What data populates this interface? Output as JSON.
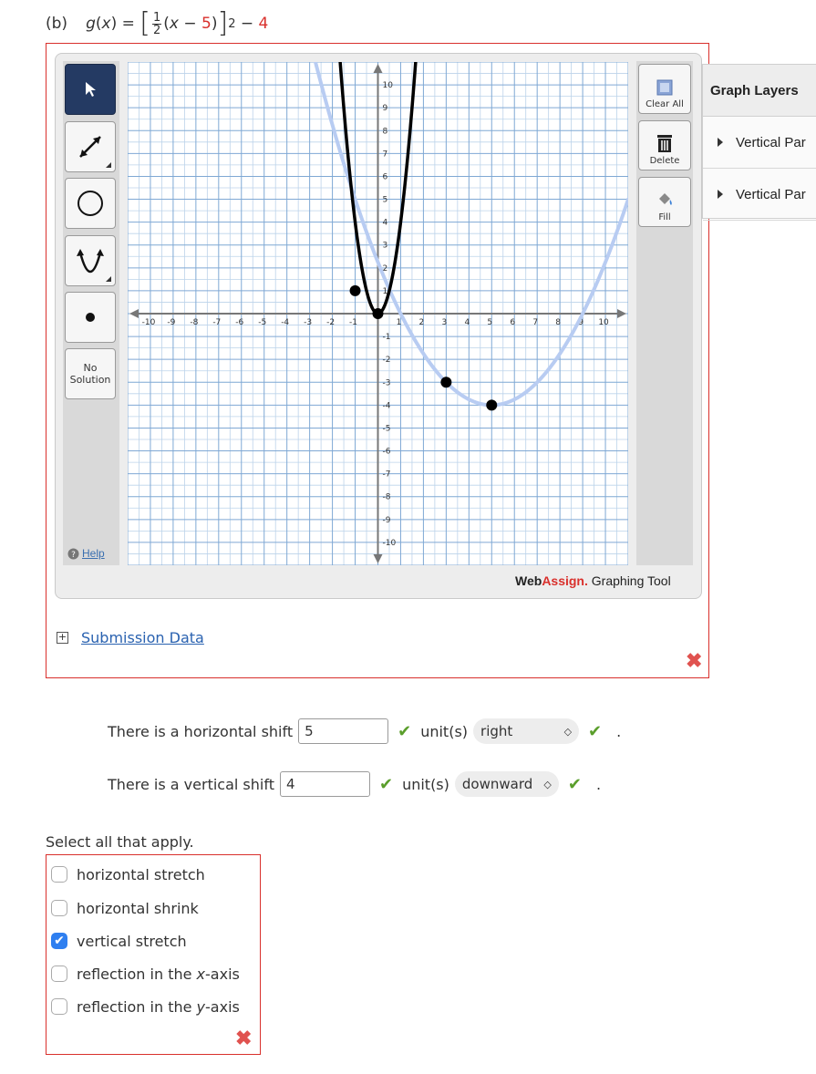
{
  "header": {
    "part": "(b)",
    "fn": "g",
    "var": "x",
    "frac_num": "1",
    "frac_den": "2",
    "shift_const": "5",
    "exponent": "2",
    "offset": "4"
  },
  "tool": {
    "clear_all": "Clear All",
    "delete": "Delete",
    "fill": "Fill",
    "no_solution_line1": "No",
    "no_solution_line2": "Solution",
    "help": "Help",
    "brand_web": "Web",
    "brand_assign": "Assign.",
    "brand_rest": " Graphing Tool"
  },
  "layers": {
    "title": "Graph Layers",
    "items": [
      "Vertical Par",
      "Vertical Par"
    ]
  },
  "submission": {
    "label": "Submission Data"
  },
  "horizontal": {
    "text": "There is a horizontal shift",
    "value": "5",
    "unit": "unit(s)",
    "direction": "right"
  },
  "vertical": {
    "text": "There is a vertical shift",
    "value": "4",
    "unit": "unit(s)",
    "direction": "downward"
  },
  "select": {
    "prompt": "Select all that apply.",
    "options": [
      {
        "label": "horizontal stretch",
        "checked": false
      },
      {
        "label": "horizontal shrink",
        "checked": false
      },
      {
        "label": "vertical stretch",
        "checked": true
      },
      {
        "label": "reflection in the ",
        "var": "x",
        "suffix": "-axis",
        "checked": false
      },
      {
        "label": "reflection in the ",
        "var": "y",
        "suffix": "-axis",
        "checked": false
      }
    ]
  },
  "graph": {
    "xmin": -11,
    "xmax": 11,
    "ymin": -11,
    "ymax": 11,
    "ticks": [
      -10,
      -9,
      -8,
      -7,
      -6,
      -5,
      -4,
      -3,
      -2,
      -1,
      1,
      2,
      3,
      4,
      5,
      6,
      7,
      8,
      9,
      10
    ],
    "dark_curve": {
      "a": 4,
      "h": 0,
      "k": 0,
      "points": [
        [
          -1,
          1
        ],
        [
          0,
          0
        ]
      ],
      "color": "#000000"
    },
    "light_curve": {
      "a": 0.25,
      "h": 5,
      "k": -4,
      "points": [
        [
          3,
          -3
        ],
        [
          5,
          -4
        ]
      ],
      "color": "#b8ccf2"
    }
  }
}
